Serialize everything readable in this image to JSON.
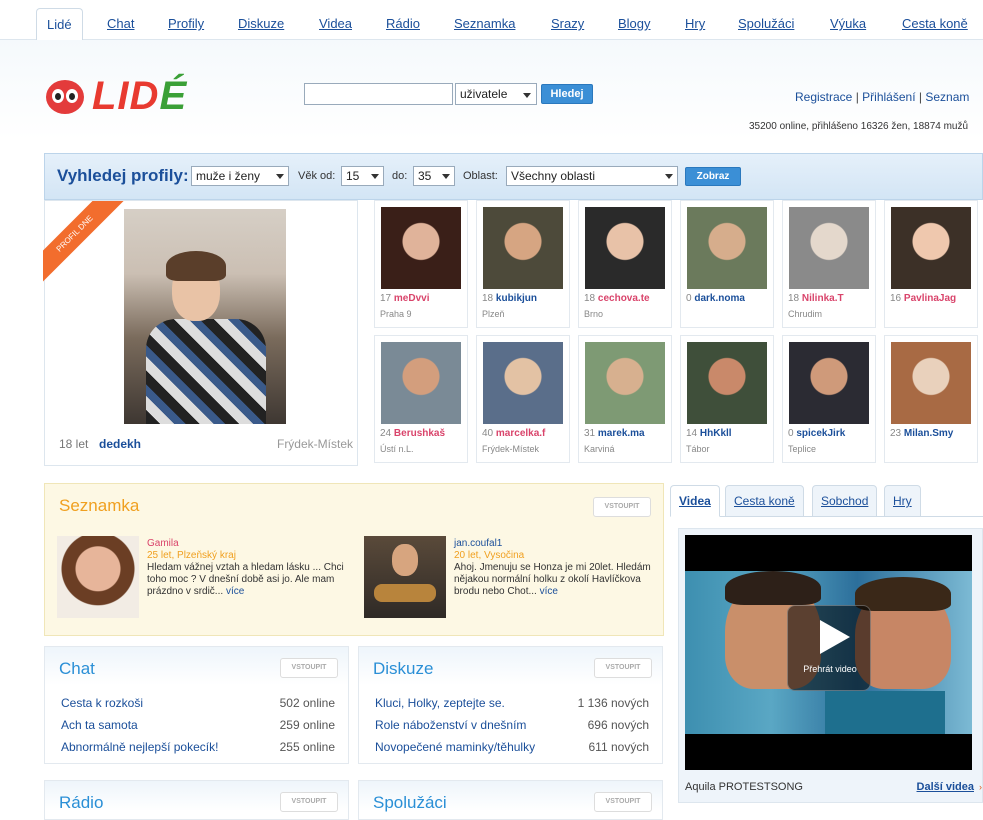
{
  "nav": {
    "tabs": [
      "Lidé",
      "Chat",
      "Profily",
      "Diskuze",
      "Videa",
      "Rádio",
      "Seznamka",
      "Srazy",
      "Blogy",
      "Hry",
      "Spolužáci",
      "Výuka",
      "Cesta koně"
    ]
  },
  "header": {
    "logo_text_main": "LID",
    "logo_text_accent": "É",
    "search_placeholder": "",
    "search_scope": "uživatele",
    "search_button": "Hledej",
    "register": "Registrace",
    "login": "Přihlášení",
    "seznam": "Seznam",
    "separator": "|",
    "online_status": "35200 online, přihlášeno 16326 žen, 18874 mužů"
  },
  "filter": {
    "title": "Vyhledej profily:",
    "gender": "muže i ženy",
    "age_from_label": "Věk od:",
    "age_from": "15",
    "age_to_label": "do:",
    "age_to": "35",
    "region_label": "Oblast:",
    "region": "Všechny oblasti",
    "submit": "Zobraz"
  },
  "featured": {
    "ribbon": "PROFIL DNE",
    "age": "18 let",
    "name": "dedekh",
    "city": "Frýdek-Místek"
  },
  "profiles": [
    {
      "age": "17",
      "name": "meDvvi",
      "city": "Praha 9",
      "color": "pink"
    },
    {
      "age": "18",
      "name": "kubikjun",
      "city": "Plzeň",
      "color": "blue"
    },
    {
      "age": "18",
      "name": "cechova.te",
      "city": "Brno",
      "color": "pink"
    },
    {
      "age": "0",
      "name": "dark.noma",
      "city": "",
      "color": "blue"
    },
    {
      "age": "18",
      "name": "Nilinka.T",
      "city": "Chrudim",
      "color": "pink"
    },
    {
      "age": "16",
      "name": "PavlinaJag",
      "city": "",
      "color": "pink"
    },
    {
      "age": "24",
      "name": "Berushkaš",
      "city": "Ústí n.L.",
      "color": "pink"
    },
    {
      "age": "40",
      "name": "marcelka.f",
      "city": "Frýdek-Místek",
      "color": "pink"
    },
    {
      "age": "31",
      "name": "marek.ma",
      "city": "Karviná",
      "color": "blue"
    },
    {
      "age": "14",
      "name": "HhKkll",
      "city": "Tábor",
      "color": "blue"
    },
    {
      "age": "0",
      "name": "spicekJirk",
      "city": "Teplice",
      "color": "blue"
    },
    {
      "age": "23",
      "name": "Milan.Smy",
      "city": "",
      "color": "blue"
    }
  ],
  "seznamka": {
    "title": "Seznamka",
    "enter": "VSTOUPIT",
    "people": [
      {
        "name": "Gamila",
        "meta": "25 let, Plzeňský kraj",
        "text": "Hledam vážnej vztah a hledam lásku ... Chci toho moc ? V dnešní době asi jo. Ale mam prázdno v srdič...",
        "more": "více"
      },
      {
        "name": "jan.coufal1",
        "meta": "20 let, Vysočina",
        "text": "Ahoj. Jmenuju se Honza je mi 20let. Hledám nějakou normální holku z okolí Havlíčkova brodu nebo Chot...",
        "more": "více"
      }
    ]
  },
  "chat": {
    "title": "Chat",
    "enter": "VSTOUPIT",
    "rooms": [
      {
        "name": "Cesta k rozkoši",
        "count": "502 online"
      },
      {
        "name": "Ach ta samota",
        "count": "259 online"
      },
      {
        "name": "Abnormálně nejlepší pokecík!",
        "count": "255 online"
      }
    ]
  },
  "diskuze": {
    "title": "Diskuze",
    "enter": "VSTOUPIT",
    "topics": [
      {
        "name": "Kluci, Holky, zeptejte se.",
        "count": "1 136 nových"
      },
      {
        "name": "Role náboženství v dnešním",
        "count": "696 nových"
      },
      {
        "name": "Novopečené maminky/těhulky",
        "count": "611 nových"
      }
    ]
  },
  "bottom": {
    "radio_title": "Rádio",
    "radio_enter": "VSTOUPIT",
    "spoluzaci_title": "Spolužáci",
    "spoluzaci_enter": "VSTOUPIT"
  },
  "media_tabs": [
    "Videa",
    "Cesta koně",
    "Sobchod",
    "Hry"
  ],
  "video": {
    "play_label": "Přehrát video",
    "title": "Aquila PROTESTSONG",
    "more": "Další videa",
    "more_arrow": "›"
  },
  "colors": {
    "link": "#1b4f9a",
    "female": "#d9446b",
    "accent_orange": "#f0a020",
    "header_blue": "#2a8fd6"
  }
}
